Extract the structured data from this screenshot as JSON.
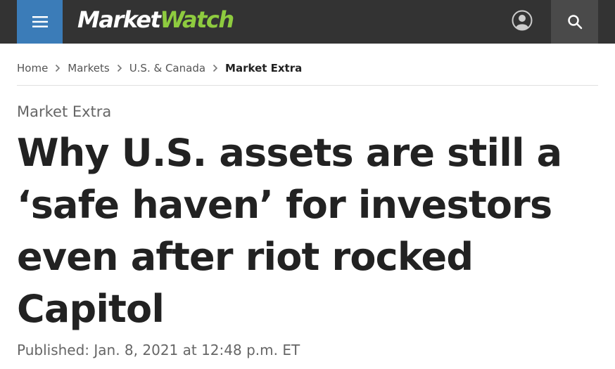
{
  "header": {
    "logo": {
      "part1": "Market",
      "part2": "Watch"
    },
    "menu_icon": "hamburger-menu-icon",
    "profile_icon": "user-profile-icon",
    "search_icon": "search-icon",
    "colors": {
      "bar": "#333333",
      "menu_button": "#3b7cb8",
      "search_button": "#4a4a4a",
      "logo_accent": "#8ecb3f"
    }
  },
  "breadcrumb": {
    "items": [
      "Home",
      "Markets",
      "U.S. & Canada",
      "Market Extra"
    ],
    "separator_icon": "chevron-right-icon"
  },
  "article": {
    "kicker": "Market Extra",
    "headline": "Why U.S. assets are still a ‘safe haven’ for investors even after riot rocked Capitol",
    "published": "Published: Jan. 8, 2021 at 12:48 p.m. ET"
  }
}
